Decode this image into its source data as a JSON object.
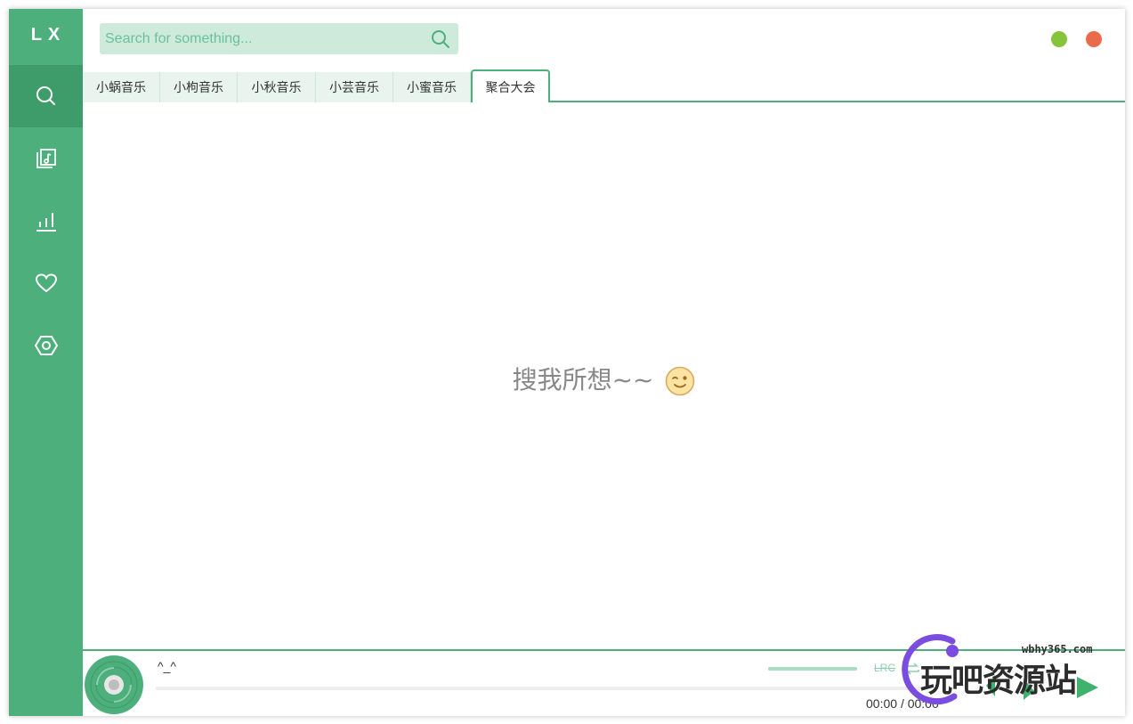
{
  "app": {
    "logo": "LX"
  },
  "sidebar": {
    "items": [
      {
        "name": "search",
        "icon": "search-icon",
        "active": true
      },
      {
        "name": "songlist",
        "icon": "music-file-icon",
        "active": false
      },
      {
        "name": "leaderboard",
        "icon": "bar-chart-icon",
        "active": false
      },
      {
        "name": "favorites",
        "icon": "heart-icon",
        "active": false
      },
      {
        "name": "settings",
        "icon": "hexagon-settings-icon",
        "active": false
      }
    ]
  },
  "search": {
    "placeholder": "Search for something..."
  },
  "tabs": [
    {
      "label": "小蜗音乐",
      "active": false
    },
    {
      "label": "小枸音乐",
      "active": false
    },
    {
      "label": "小秋音乐",
      "active": false
    },
    {
      "label": "小芸音乐",
      "active": false
    },
    {
      "label": "小蜜音乐",
      "active": false
    },
    {
      "label": "聚合大会",
      "active": true
    }
  ],
  "main": {
    "empty_message": "搜我所想~~"
  },
  "player": {
    "song_title": "^_^",
    "current_time": "00:00",
    "time_separator": "/",
    "total_time": "00:00",
    "lrc_label": "LRC",
    "progress": 0
  },
  "watermark": {
    "url": "wbhy365.com",
    "text": "玩吧资源站"
  },
  "colors": {
    "accent": "#4daf7c",
    "accent_dark": "#3d9c69",
    "search_bg": "#cdeada",
    "minimize": "#85c43b",
    "close": "#e96b4c"
  }
}
